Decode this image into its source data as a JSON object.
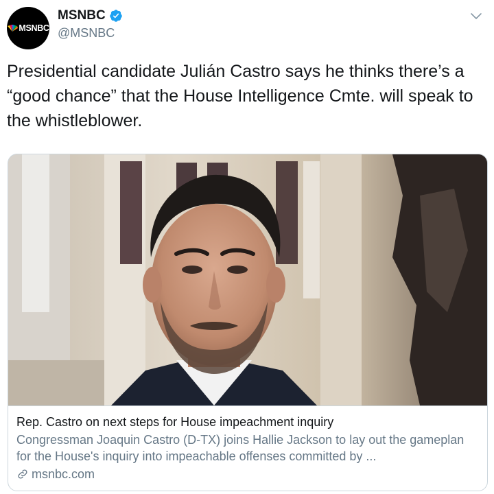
{
  "account": {
    "display_name": "MSNBC",
    "handle": "@MSNBC",
    "avatar_text": "MSNBC",
    "verified": true
  },
  "tweet": {
    "text": "Presidential candidate Julián Castro says he thinks there’s a “good chance” that the House Intelligence Cmte. will speak to the whistleblower."
  },
  "card": {
    "title": "Rep. Castro on next steps for House impeachment inquiry",
    "description": "Congressman Joaquin Castro (D-TX) joins Hallie Jackson to lay out the gameplan for the House's inquiry into impeachable offenses committed by ...",
    "domain": "msnbc.com"
  },
  "icons": {
    "verified": "verified-badge-icon",
    "caret": "chevron-down-icon",
    "link": "link-icon",
    "logo": "peacock-icon"
  },
  "colors": {
    "verified": "#1da1f2",
    "secondary_text": "#657786",
    "border": "#ccd6dd"
  }
}
